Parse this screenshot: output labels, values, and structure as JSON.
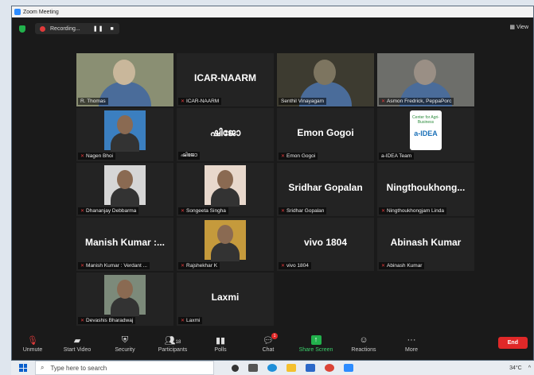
{
  "window": {
    "title": "Zoom Meeting"
  },
  "topbar": {
    "recording_label": "Recording...",
    "pause_symbol": "❚❚",
    "stop_symbol": "■",
    "view_label": "View"
  },
  "participants": [
    {
      "label": "R. Thomas",
      "display": ""
    },
    {
      "label": "ICAR-NAARM",
      "display": "ICAR-NAARM"
    },
    {
      "label": "Senthil Vinayagam",
      "display": ""
    },
    {
      "label": "Asmon Fredrick, PeppaPorc",
      "display": ""
    },
    {
      "label": "Nagen Bhoi",
      "display": ""
    },
    {
      "label": "ഷിജോ",
      "display": "ഷിജോ"
    },
    {
      "label": "Emon Gogoi",
      "display": "Emon Gogoi"
    },
    {
      "label": "a-IDEA Team",
      "display": ""
    },
    {
      "label": "Dhananjay Debbarma",
      "display": ""
    },
    {
      "label": "Songeeta Singha",
      "display": ""
    },
    {
      "label": "Sridhar Gopalan",
      "display": "Sridhar Gopalan"
    },
    {
      "label": "Ningthoukhongjam Linda",
      "display": "Ningthoukhong..."
    },
    {
      "label": "Manish Kumar : Verdant ...",
      "display": "Manish Kumar :..."
    },
    {
      "label": "Rajshekhar K",
      "display": ""
    },
    {
      "label": "vivo 1804",
      "display": "vivo 1804"
    },
    {
      "label": "Abinash Kumar",
      "display": "Abinash Kumar"
    },
    {
      "label": "Devashis Bharadwaj",
      "display": ""
    },
    {
      "label": "Laxmi",
      "display": "Laxmi"
    }
  ],
  "logo_text": "Center for Agri-Business",
  "logo_brand": "a-IDEA",
  "toolbar": {
    "unmute": "Unmute",
    "start_video": "Start Video",
    "security": "Security",
    "participants": "Participants",
    "participants_count": "18",
    "polls": "Polls",
    "chat": "Chat",
    "chat_badge": "1",
    "share_screen": "Share Screen",
    "reactions": "Reactions",
    "more": "More",
    "end": "End"
  },
  "taskbar": {
    "search_placeholder": "Type here to search",
    "temperature": "34°C"
  }
}
